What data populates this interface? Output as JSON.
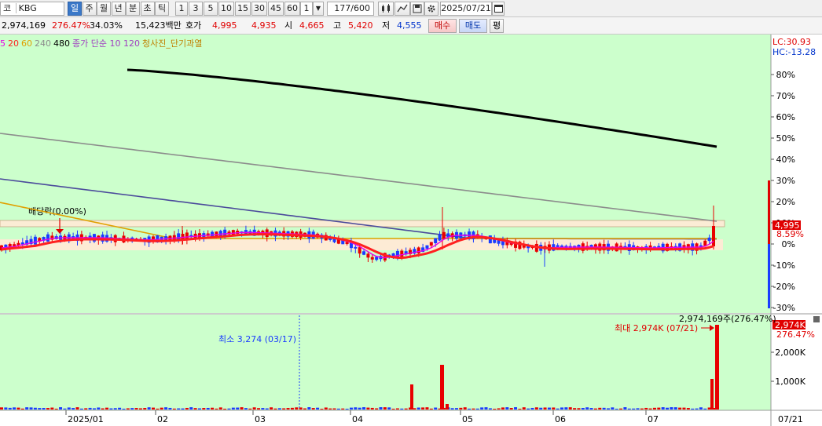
{
  "toolbar": {
    "market_label": "코",
    "code_value": "KBG",
    "periods": [
      "일",
      "주",
      "월",
      "년",
      "분",
      "초",
      "틱"
    ],
    "selected_period": "일",
    "intervals": [
      "1",
      "3",
      "5",
      "10",
      "15",
      "30",
      "45",
      "60"
    ],
    "interval_select_value": "1",
    "count_display": "177/600",
    "date_value": "2025/07/21"
  },
  "info": {
    "volume": "2,974,169",
    "volume_ratio": "276.47%",
    "turnover_rate": "34.03%",
    "trade_value": "15,423백만",
    "quote_label": "호가",
    "ask": "4,995",
    "bid": "4,935",
    "open_label": "시",
    "open": "4,665",
    "high_label": "고",
    "high": "5,420",
    "low_label": "저",
    "low": "4,555",
    "buy_button": "매수",
    "sell_button": "매도",
    "avg_button": "평"
  },
  "legend": {
    "ma": [
      "5",
      "20",
      "60",
      "240",
      "480"
    ],
    "volume_ma": "종가 단순 10 120",
    "indicator": "청사진_단기과열"
  },
  "colors": {
    "chart_bg": "#ccffcc",
    "up": "#e80000",
    "down": "#1a3cff",
    "ma5": "#e800e8",
    "ma20": "#ff2020",
    "ma60": "#e0a000",
    "ma240": "#8c8c8c",
    "ma480": "#4b4b9b",
    "long_line": "#000000"
  },
  "price_panel": {
    "y_axis_labels": [
      "80%",
      "70%",
      "60%",
      "50%",
      "40%",
      "30%",
      "20%",
      "10%",
      "0%",
      "-10%",
      "-20%",
      "-30%"
    ],
    "lc": "LC:30.93",
    "hc": "HC:-13.28",
    "current_price": "4,995",
    "current_change": "8.59%",
    "dividend_label": "배당락(0.00%)"
  },
  "volume_panel": {
    "y_axis_labels": [
      "2,000K",
      "1,000K"
    ],
    "current_volume_tag": "2,974K",
    "current_ratio": "276.47%",
    "min_label": "최소 3,274 (03/17)",
    "max_label": "최대 2,974K (07/21)",
    "last_volume_label": "2,974,169주(276.47%)"
  },
  "x_axis_labels": [
    "2025/01",
    "02",
    "03",
    "04",
    "05",
    "06",
    "07"
  ],
  "x_axis_right_label": "07/21",
  "chart_data": {
    "type": "candlestick",
    "x_axis_labels": [
      "2025/01",
      "02",
      "03",
      "04",
      "05",
      "06",
      "07",
      "07/21"
    ],
    "y_axis_labels": [
      "80%",
      "70%",
      "60%",
      "50%",
      "40%",
      "30%",
      "20%",
      "10%",
      "0%",
      "-10%",
      "-20%",
      "-30%"
    ],
    "volume_y_axis_labels": [
      "2,000K",
      "1,000K"
    ],
    "last_candle": {
      "open": 4665,
      "high": 5420,
      "low": 4555,
      "close": 4995,
      "change_pct": 8.59
    },
    "last_volume": 2974169,
    "min_volume": 3274,
    "max_volume": 2974169,
    "series": [
      {
        "name": "5"
      },
      {
        "name": "20"
      },
      {
        "name": "60"
      },
      {
        "name": "240"
      },
      {
        "name": "480"
      }
    ]
  }
}
